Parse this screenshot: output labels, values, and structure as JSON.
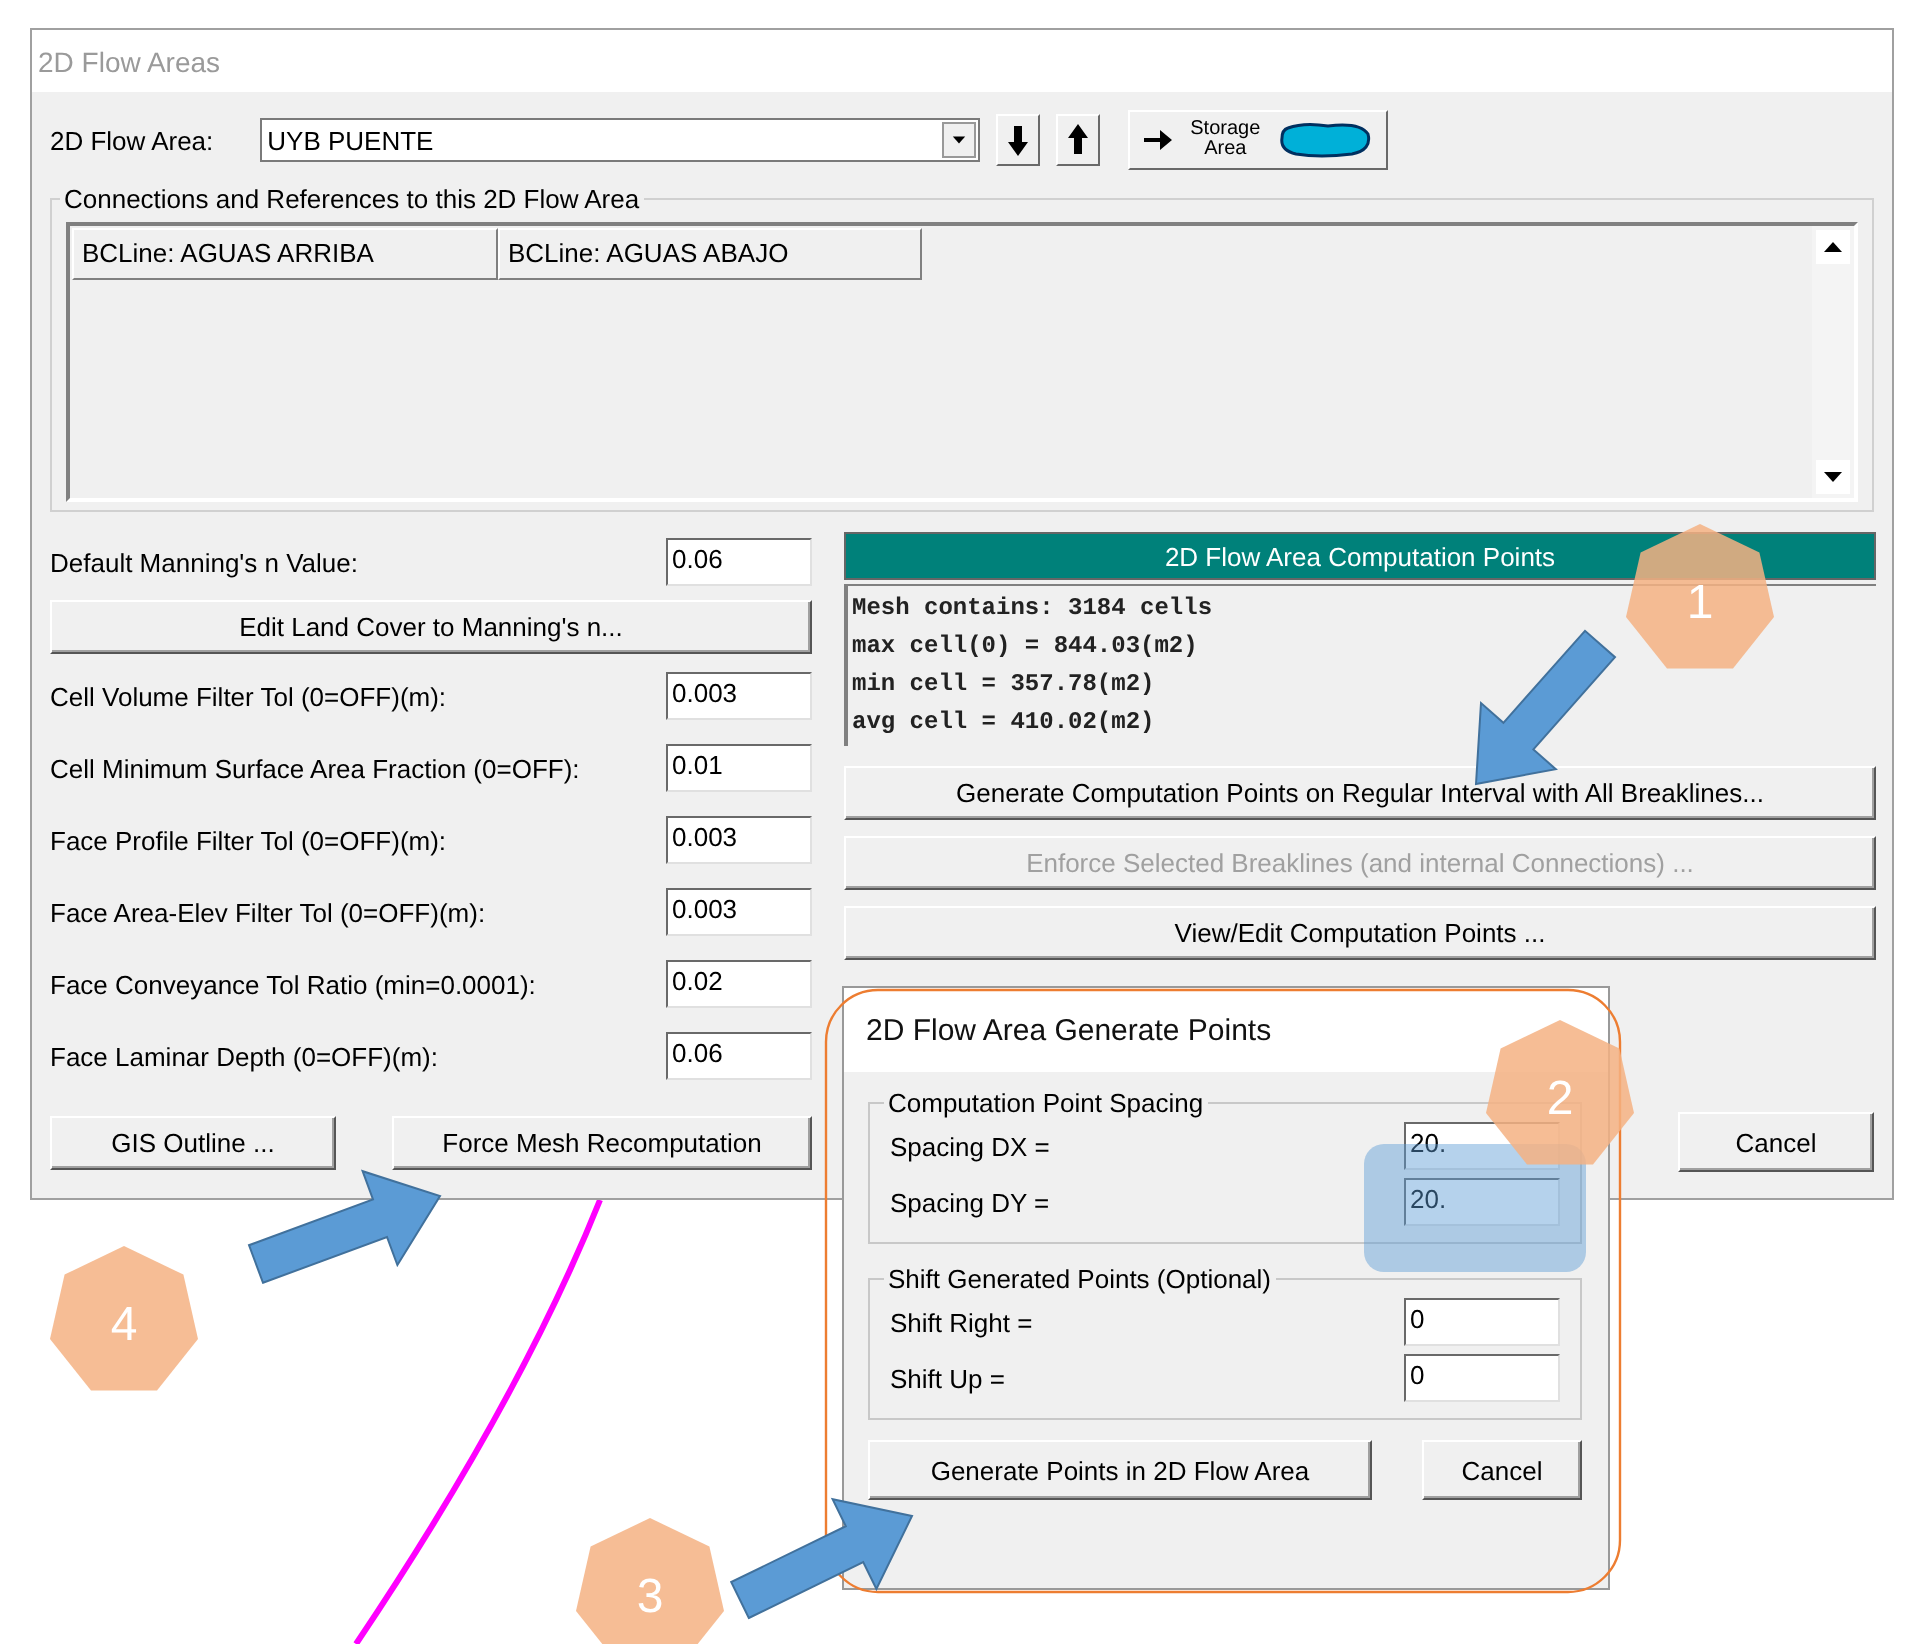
{
  "window": {
    "title": "2D Flow Areas"
  },
  "flow_area": {
    "label": "2D Flow Area:",
    "value": "UYB PUENTE",
    "storage_button": "Storage Area"
  },
  "connections": {
    "title": "Connections and References to this 2D Flow Area",
    "items": [
      "BCLine: AGUAS ARRIBA",
      "BCLine: AGUAS ABAJO"
    ]
  },
  "parameters": [
    {
      "kind": "field",
      "label": "Default Manning's n Value:",
      "value": "0.06"
    },
    {
      "kind": "button",
      "label": "Edit Land Cover to Manning's n..."
    },
    {
      "kind": "field",
      "label": "Cell Volume Filter Tol (0=OFF)(m):",
      "value": "0.003"
    },
    {
      "kind": "field",
      "label": "Cell Minimum Surface Area Fraction (0=OFF):",
      "value": "0.01"
    },
    {
      "kind": "field",
      "label": "Face Profile Filter Tol (0=OFF)(m):",
      "value": "0.003"
    },
    {
      "kind": "field",
      "label": "Face Area-Elev Filter Tol (0=OFF)(m):",
      "value": "0.003"
    },
    {
      "kind": "field",
      "label": "Face Conveyance Tol Ratio (min=0.0001):",
      "value": "0.02"
    },
    {
      "kind": "field",
      "label": "Face Laminar Depth (0=OFF)(m):",
      "value": "0.06"
    }
  ],
  "computation_points": {
    "title": "2D Flow Area Computation Points",
    "mesh_info": [
      "Mesh contains: 3184 cells",
      "max cell(0) = 844.03(m2)",
      "min cell = 357.78(m2)",
      "avg cell = 410.02(m2)"
    ],
    "buttons": [
      {
        "label": "Generate Computation Points on Regular Interval with All Breaklines...",
        "disabled": false
      },
      {
        "label": "Enforce Selected Breaklines (and internal Connections) ...",
        "disabled": true
      },
      {
        "label": "View/Edit Computation Points ...",
        "disabled": false
      }
    ]
  },
  "bottom_buttons": [
    "GIS Outline ...",
    "Force Mesh Recomputation"
  ],
  "cancel": "Cancel",
  "dialog": {
    "title": "2D Flow Area Generate Points",
    "groups": [
      {
        "title": "Computation Point Spacing",
        "fields": [
          {
            "label": "Spacing DX =",
            "value": "20."
          },
          {
            "label": "Spacing DY =",
            "value": "20."
          }
        ]
      },
      {
        "title": "Shift Generated Points (Optional)",
        "fields": [
          {
            "label": "Shift Right =",
            "value": "0"
          },
          {
            "label": "Shift Up =",
            "value": "0"
          }
        ]
      }
    ],
    "buttons": [
      "Generate Points in 2D Flow Area",
      "Cancel"
    ]
  },
  "callouts": [
    "1",
    "2",
    "3",
    "4"
  ]
}
